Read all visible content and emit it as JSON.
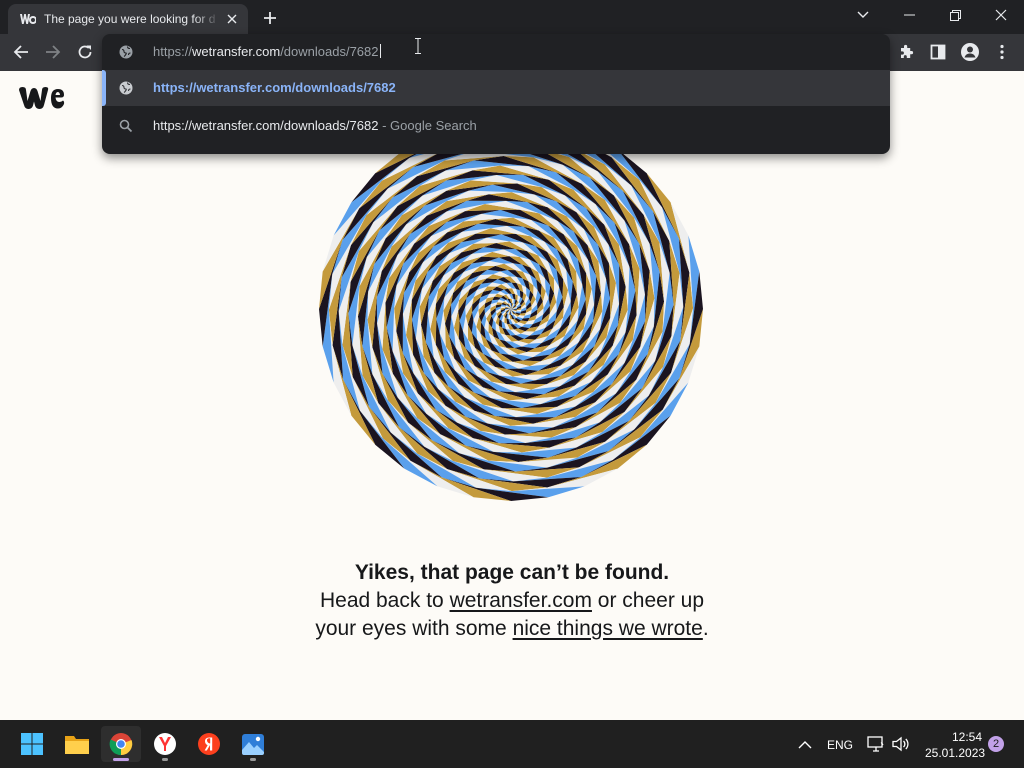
{
  "browser": {
    "tab": {
      "title": "The page you were looking for d"
    },
    "omnibox": {
      "url_prefix": "https://",
      "url_host": "wetransfer.com",
      "url_path": "/downloads/7682",
      "suggestion_selected": "https://wetransfer.com/downloads/7682",
      "suggestion_search_query": "https://wetransfer.com/downloads/7682",
      "suggestion_search_sep": " - ",
      "suggestion_search_engine": "Google Search"
    }
  },
  "page": {
    "heading": "Yikes, that page can’t be found.",
    "text_before": "Head back to ",
    "link_home": "wetransfer.com",
    "text_middle": " or cheer up your eyes with some ",
    "link_blog": "nice things we wrote",
    "text_end": "."
  },
  "taskbar": {
    "apps": [
      "start",
      "file-explorer",
      "chrome",
      "yandex-browser",
      "yandex",
      "photos"
    ],
    "language": "ENG",
    "time": "12:54",
    "date": "25.01.2023",
    "notifications": "2"
  },
  "colors": {
    "spiral_black": "#1b1420",
    "spiral_gold": "#c49a3c",
    "spiral_white": "#eeeeee",
    "spiral_blue": "#5aa0ec",
    "page_bg": "#fdfbf7",
    "link_blue": "#8ab4f8"
  }
}
